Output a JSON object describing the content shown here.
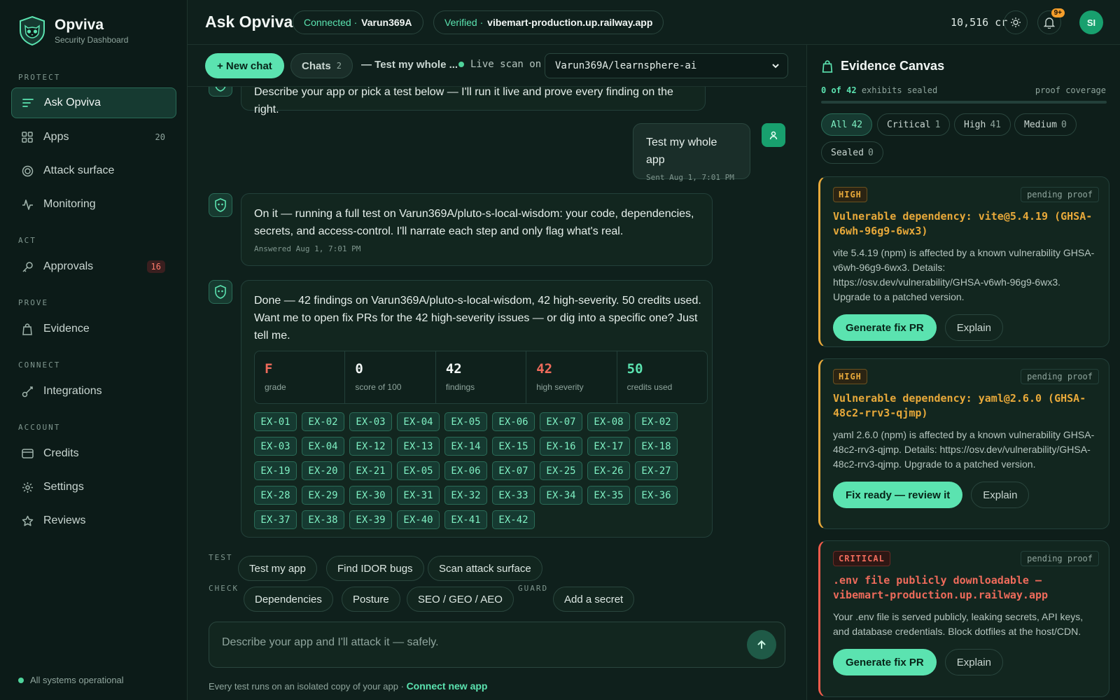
{
  "brand": {
    "name": "Opviva",
    "subtitle": "Security Dashboard"
  },
  "sidebar": {
    "sections": [
      "PROTECT",
      "ACT",
      "PROVE",
      "CONNECT",
      "ACCOUNT"
    ],
    "items": [
      {
        "label": "Ask Opviva",
        "icon": "list-icon"
      },
      {
        "label": "Apps",
        "icon": "grid-icon",
        "badge": "20"
      },
      {
        "label": "Attack surface",
        "icon": "target-icon"
      },
      {
        "label": "Monitoring",
        "icon": "pulse-icon"
      },
      {
        "label": "Approvals",
        "icon": "key-icon",
        "badge": "16"
      },
      {
        "label": "Evidence",
        "icon": "bag-icon"
      },
      {
        "label": "Integrations",
        "icon": "link-icon"
      },
      {
        "label": "Credits",
        "icon": "card-icon"
      },
      {
        "label": "Settings",
        "icon": "gear-icon"
      },
      {
        "label": "Reviews",
        "icon": "star-icon"
      }
    ],
    "status": "All systems operational"
  },
  "header": {
    "title": "Ask Opviva",
    "connected_label": "Connected",
    "connected_value": "Varun369A",
    "verified_label": "Verified",
    "verified_value": "vibemart-production.up.railway.app",
    "credits": "10,516 cr",
    "notifications_badge": "9+",
    "avatar": "SI"
  },
  "toolbar": {
    "new_chat": "+ New chat",
    "chats_label": "Chats",
    "chats_count": "2",
    "chat_title": "— Test my whole ...",
    "live_scan": "Live scan on",
    "repo": "Varun369A/learnsphere-ai"
  },
  "messages": {
    "intro": "Describe your app or pick a test below — I'll run it live and prove every finding on the right.",
    "user_text": "Test my whole app",
    "user_meta": "Sent Aug 1, 7:01 PM",
    "bot1_text": "On it — running a full test on Varun369A/pluto-s-local-wisdom: your code, dependencies, secrets, and access-control. I'll narrate each step and only flag what's real.",
    "bot1_meta": "Answered Aug 1, 7:01 PM",
    "bot2_text": "Done — 42 findings on Varun369A/pluto-s-local-wisdom, 42 high-severity. 50 credits used. Want me to open fix PRs for the 42 high-severity issues — or dig into a specific one? Just tell me."
  },
  "stats": [
    {
      "value": "F",
      "label": "grade",
      "color": "#ef6b5b"
    },
    {
      "value": "0",
      "label": "score of 100",
      "color": "#f1f6f4"
    },
    {
      "value": "42",
      "label": "findings",
      "color": "#f1f6f4"
    },
    {
      "value": "42",
      "label": "high severity",
      "color": "#ef6b5b"
    },
    {
      "value": "50",
      "label": "credits used",
      "color": "#5be3b0"
    }
  ],
  "exhibits": [
    "EX-01",
    "EX-02",
    "EX-03",
    "EX-04",
    "EX-05",
    "EX-06",
    "EX-07",
    "EX-08",
    "EX-02",
    "EX-03",
    "EX-04",
    "EX-12",
    "EX-13",
    "EX-14",
    "EX-15",
    "EX-16",
    "EX-17",
    "EX-18",
    "EX-19",
    "EX-20",
    "EX-21",
    "EX-05",
    "EX-06",
    "EX-07",
    "EX-25",
    "EX-26",
    "EX-27",
    "EX-28",
    "EX-29",
    "EX-30",
    "EX-31",
    "EX-32",
    "EX-33",
    "EX-34",
    "EX-35",
    "EX-36",
    "EX-37",
    "EX-38",
    "EX-39",
    "EX-40",
    "EX-41",
    "EX-42"
  ],
  "quick": {
    "test_label": "TEST",
    "check_label": "CHECK",
    "guard_label": "GUARD",
    "test": [
      "Test my app",
      "Find IDOR bugs",
      "Scan attack surface"
    ],
    "check": [
      "Dependencies",
      "Posture",
      "SEO / GEO / AEO"
    ],
    "guard": [
      "Add a secret"
    ]
  },
  "composer": {
    "placeholder": "Describe your app and I'll attack it — safely.",
    "note": "Every test runs on an isolated copy of your app ·",
    "link": "Connect new app"
  },
  "evidence": {
    "title": "Evidence Canvas",
    "sealed_count": "0 of 42",
    "sealed_suffix": "exhibits sealed",
    "coverage_label": "proof coverage",
    "coverage": 0,
    "filters": [
      {
        "label": "All",
        "count": "42"
      },
      {
        "label": "Critical",
        "count": "1"
      },
      {
        "label": "High",
        "count": "41"
      },
      {
        "label": "Medium",
        "count": "0"
      },
      {
        "label": "Sealed",
        "count": "0"
      }
    ],
    "cards": [
      {
        "severity": "HIGH",
        "status": "pending proof",
        "title": "Vulnerable dependency: vite@5.4.19 (GHSA-v6wh-96g9-6wx3)",
        "desc": "vite 5.4.19 (npm) is affected by a known vulnerability GHSA-v6wh-96g9-6wx3. Details: https://osv.dev/vulnerability/GHSA-v6wh-96g9-6wx3. Upgrade to a patched version.",
        "primary": "Generate fix PR",
        "secondary": "Explain"
      },
      {
        "severity": "HIGH",
        "status": "pending proof",
        "title": "Vulnerable dependency: yaml@2.6.0 (GHSA-48c2-rrv3-qjmp)",
        "desc": "yaml 2.6.0 (npm) is affected by a known vulnerability GHSA-48c2-rrv3-qjmp. Details: https://osv.dev/vulnerability/GHSA-48c2-rrv3-qjmp. Upgrade to a patched version.",
        "primary": "Fix ready — review it",
        "secondary": "Explain"
      },
      {
        "severity": "CRITICAL",
        "status": "pending proof",
        "title": ".env file publicly downloadable — vibemart-production.up.railway.app",
        "desc": "Your .env file is served publicly, leaking secrets, API keys, and database credentials. Block dotfiles at the host/CDN.",
        "primary": "Generate fix PR",
        "secondary": "Explain"
      }
    ]
  }
}
